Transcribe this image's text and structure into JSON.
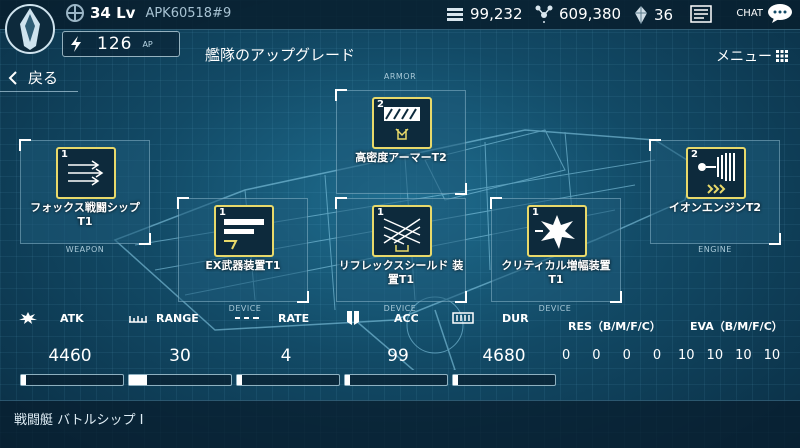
{
  "player": {
    "level": "34 Lv",
    "uid": "APK60518#9"
  },
  "resources": {
    "credits": "99,232",
    "metal": "609,380",
    "crystal": "36",
    "chat_label": "CHAT"
  },
  "ap": {
    "value": "126",
    "unit": "AP"
  },
  "screen": {
    "title": "艦隊のアップグレード",
    "menu_label": "メニュー",
    "back_label": "戻る"
  },
  "slots": {
    "armor_label": "ARMOR",
    "weapon_label": "WEAPON",
    "engine_label": "ENGINE",
    "device_label": "DEVICE"
  },
  "modules": [
    {
      "tier": "1",
      "name": "フォックス戦闘シップ T1",
      "slot": "WEAPON"
    },
    {
      "tier": "1",
      "name": "EX武器装置T1",
      "slot": "DEVICE"
    },
    {
      "tier": "2",
      "name": "高密度アーマーT2",
      "slot": "ARMOR"
    },
    {
      "tier": "1",
      "name": "リフレックスシールド 装置T1",
      "slot": "DEVICE"
    },
    {
      "tier": "1",
      "name": "クリティカル増幅装置 T1",
      "slot": "DEVICE"
    },
    {
      "tier": "2",
      "name": "イオンエンジンT2",
      "slot": "ENGINE"
    }
  ],
  "stats": [
    {
      "label": "ATK",
      "value": "4460",
      "fill": 0.05,
      "icon": "burst-icon"
    },
    {
      "label": "RANGE",
      "value": "30",
      "fill": 0.18,
      "icon": "ruler-icon"
    },
    {
      "label": "RATE",
      "value": "4",
      "fill": 0.05,
      "icon": "dash-icon"
    },
    {
      "label": "ACC",
      "value": "99",
      "fill": 0.05,
      "icon": "banner-icon"
    },
    {
      "label": "DUR",
      "value": "4680",
      "fill": 0.05,
      "icon": "battery-icon"
    }
  ],
  "res_stats": {
    "label": "RES（B/M/F/C）",
    "values": [
      "0",
      "0",
      "0",
      "0"
    ]
  },
  "eva_stats": {
    "label": "EVA（B/M/F/C）",
    "values": [
      "10",
      "10",
      "10",
      "10"
    ]
  },
  "ship_class": "戦闘艇 バトルシップ I",
  "colors": {
    "accent_yellow": "#e8d96a",
    "bg": "#124a66",
    "frame": "#ffffff"
  }
}
